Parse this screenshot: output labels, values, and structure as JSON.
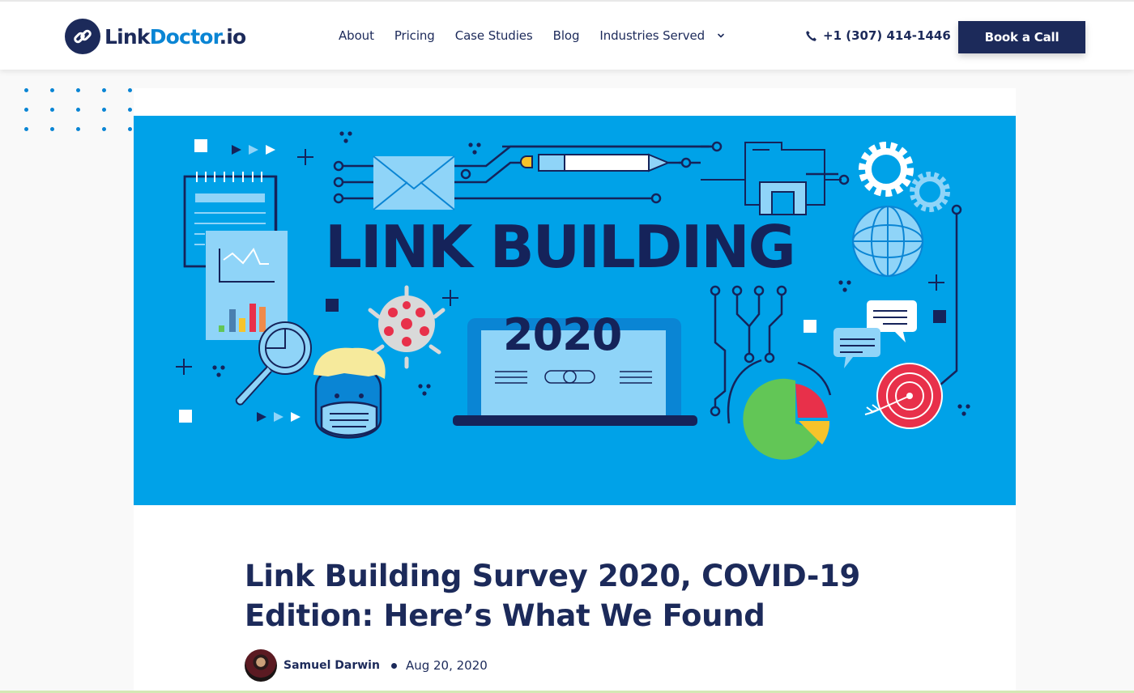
{
  "header": {
    "logo": {
      "part1": "Link",
      "part2": "Doctor",
      "part3": ".io",
      "icon": "chain-link-icon"
    },
    "nav": [
      {
        "label": "About"
      },
      {
        "label": "Pricing"
      },
      {
        "label": "Case Studies"
      },
      {
        "label": "Blog"
      },
      {
        "label": "Industries Served",
        "has_dropdown": true
      }
    ],
    "phone": {
      "icon": "phone-icon",
      "number": "+1 (307) 414-1446"
    },
    "cta_label": "Book a Call"
  },
  "hero": {
    "title": "LINK BUILDING",
    "year": "2020",
    "alt": "Link Building 2020 illustration"
  },
  "article": {
    "title": "Link Building Survey 2020, COVID-19 Edition: Here’s What We Found",
    "author": "Samuel Darwin",
    "date": "Aug 20, 2020"
  },
  "colors": {
    "brand_navy": "#1c2a5a",
    "brand_blue": "#0a85d4",
    "hero_bg": "#00a2e8",
    "page_bg": "#f9f9f9"
  }
}
